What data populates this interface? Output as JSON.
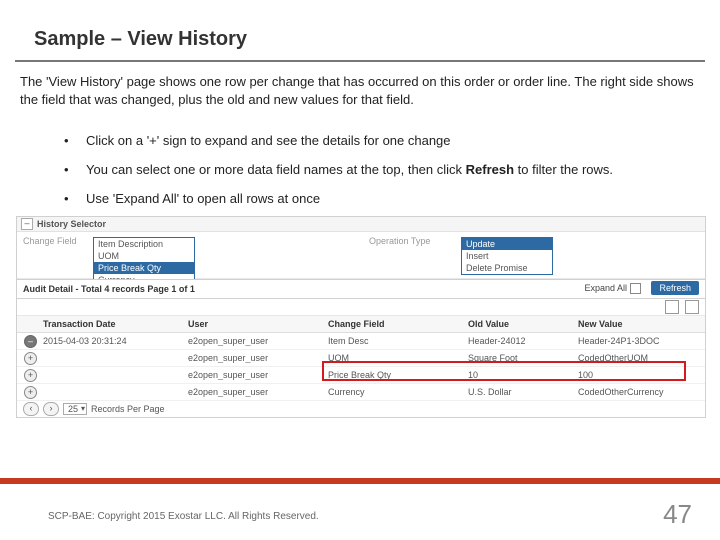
{
  "title": "Sample – View History",
  "intro": "The 'View History' page shows one row per change that has occurred on this order or order line. The right side shows the field that was changed, plus the old and new values for that field.",
  "bullets": [
    "Click on a '+' sign to expand and see the details for one change",
    "You can select one or more data field names at the top, then click ",
    "Use 'Expand All' to open all rows at once"
  ],
  "bullet2_bold": "Refresh",
  "bullet2_tail": " to filter the rows.",
  "shot": {
    "hs_title": "History Selector",
    "change_field_label": "Change Field",
    "change_field_opts": [
      "Item Description",
      "UOM",
      "Price Break Qty",
      "Currency"
    ],
    "change_field_selected": "Price Break Qty",
    "op_label": "Operation Type",
    "op_opts": [
      "Update",
      "Insert",
      "Delete Promise"
    ],
    "op_selected": "Update",
    "audit_title": "Audit Detail - Total 4 records Page 1 of 1",
    "expand_all": "Expand All",
    "refresh": "Refresh",
    "cols": {
      "date": "Transaction Date",
      "user": "User",
      "chg": "Change Field",
      "old": "Old Value",
      "new": "New Value"
    },
    "rows": [
      {
        "exp": "minus",
        "date": "2015-04-03 20:31:24",
        "user": "e2open_super_user",
        "chg": "Item Desc",
        "old": "Header-24012",
        "new": "Header-24P1-3DOC"
      },
      {
        "exp": "plus",
        "date": "",
        "user": "e2open_super_user",
        "chg": "UOM",
        "old": "Square Foot",
        "new": "CodedOtherUOM"
      },
      {
        "exp": "plus",
        "date": "",
        "user": "e2open_super_user",
        "chg": "Price Break Qty",
        "old": "10",
        "new": "100"
      },
      {
        "exp": "plus",
        "date": "",
        "user": "e2open_super_user",
        "chg": "Currency",
        "old": "U.S. Dollar",
        "new": "CodedOtherCurrency"
      }
    ],
    "pager_size": "25",
    "pager_label": "Records Per Page"
  },
  "footer": "SCP-BAE: Copyright 2015 Exostar LLC. All Rights Reserved.",
  "page_no": "47"
}
